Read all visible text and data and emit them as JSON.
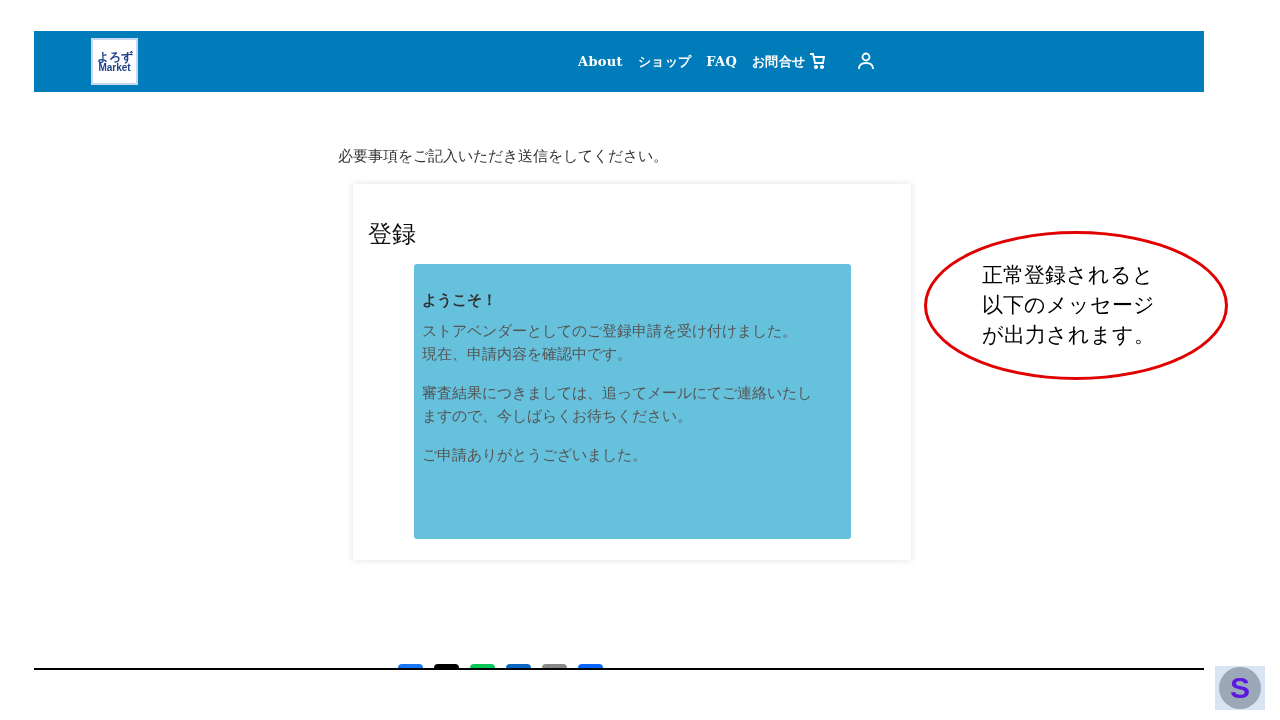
{
  "header": {
    "logo_lines": [
      "よろず",
      "Market"
    ],
    "nav": [
      "About",
      "ショップ",
      "FAQ",
      "お問合せ"
    ]
  },
  "intro": "必要事項をご記入いただき送信をしてください。",
  "card": {
    "title": "登録",
    "message": {
      "heading": "ようこそ！",
      "paragraphs": [
        [
          "ストアベンダーとしてのご登録申請を受け付けました。",
          "現在、申請内容を確認中です。"
        ],
        [
          "審査結果につきましては、追ってメールにてご連絡いたし",
          "ますので、今しばらくお待ちください。"
        ],
        [
          "ご申請ありがとうございました。"
        ]
      ]
    }
  },
  "annotation": [
    "正常登録されると",
    "以下のメッセージ",
    "が出力されます。"
  ],
  "share_buttons": [
    {
      "color": "#1877f2"
    },
    {
      "color": "#000000"
    },
    {
      "color": "#06c755"
    },
    {
      "color": "#0a66c2"
    },
    {
      "color": "#888888"
    },
    {
      "color": "#0866ff"
    }
  ],
  "corner_logo": "S"
}
